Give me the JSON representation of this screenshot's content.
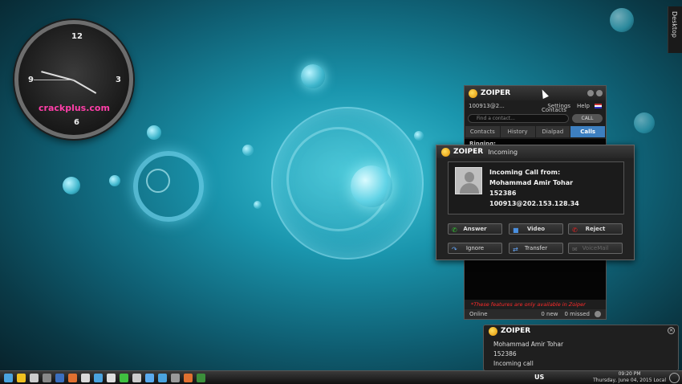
{
  "desktop": {
    "side_label": "Desktop",
    "clock": {
      "numerals": [
        "12",
        "3",
        "6",
        "9"
      ],
      "watermark": "crackplus.com"
    }
  },
  "zoiper_main": {
    "title": "ZOIPER",
    "account": "100913@2...",
    "menu": [
      "Settings",
      "Help"
    ],
    "hover_tooltip": "Contacts",
    "search_placeholder": "Find a contact...",
    "call_button": "CALL",
    "tabs": [
      {
        "label": "Contacts",
        "active": false
      },
      {
        "label": "History",
        "active": false
      },
      {
        "label": "Dialpad",
        "active": false
      },
      {
        "label": "Calls",
        "active": true
      }
    ],
    "calls_status": "Ringing:",
    "notice": "*These features are only available in Zoiper",
    "status": {
      "presence": "Online",
      "new_count": "0 new",
      "missed_count": "0 missed"
    }
  },
  "incoming_dialog": {
    "title": "ZOIPER",
    "subtitle": "Incoming",
    "heading": "Incoming Call from:",
    "caller_name": "Mohammad Amir Tohar",
    "caller_number": "152386",
    "caller_uri": "100913@202.153.128.34",
    "buttons": {
      "answer": "Answer",
      "video": "Video",
      "reject": "Reject",
      "ignore": "Ignore",
      "transfer": "Transfer",
      "voicemail": "VoiceMail"
    }
  },
  "notification": {
    "title": "ZOIPER",
    "name": "Mohammad Amir Tohar",
    "number": "152386",
    "message": "Incoming call"
  },
  "taskbar": {
    "language": "US",
    "time": "09:20 PM",
    "date": "Thursday, June 04, 2015 Local",
    "icon_colors": [
      "#4aa3df",
      "#f0c020",
      "#ccc",
      "#888",
      "#3b6fbf",
      "#e07030",
      "#d9d9d9",
      "#4aa3df",
      "#ddd",
      "#40c040",
      "#ccc",
      "#5aaaee",
      "#4aa3df",
      "#999",
      "#e07030",
      "#3b8f3b"
    ]
  }
}
